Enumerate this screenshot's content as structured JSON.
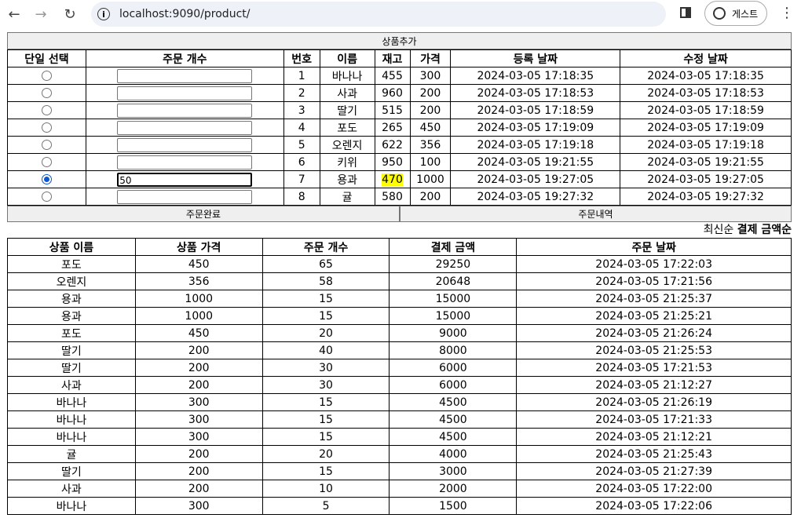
{
  "browser": {
    "url": "localhost:9090/product/",
    "profile_label": "게스트",
    "icons": [
      "back-arrow-icon",
      "forward-arrow-icon",
      "reload-icon",
      "info-icon",
      "side-panel-icon",
      "profile-icon",
      "more-vert-icon"
    ]
  },
  "product": {
    "add_button": "상품추가",
    "headers": [
      "단일 선택",
      "주문 개수",
      "번호",
      "이름",
      "재고",
      "가격",
      "등록 날짜",
      "수정 날짜"
    ],
    "rows": [
      {
        "selected": false,
        "qty": "",
        "id": "1",
        "name": "바나나",
        "stock": "455",
        "price": "300",
        "created": "2024-03-05 17:18:35",
        "updated": "2024-03-05 17:18:35"
      },
      {
        "selected": false,
        "qty": "",
        "id": "2",
        "name": "사과",
        "stock": "960",
        "price": "200",
        "created": "2024-03-05 17:18:53",
        "updated": "2024-03-05 17:18:53"
      },
      {
        "selected": false,
        "qty": "",
        "id": "3",
        "name": "딸기",
        "stock": "515",
        "price": "200",
        "created": "2024-03-05 17:18:59",
        "updated": "2024-03-05 17:18:59"
      },
      {
        "selected": false,
        "qty": "",
        "id": "4",
        "name": "포도",
        "stock": "265",
        "price": "450",
        "created": "2024-03-05 17:19:09",
        "updated": "2024-03-05 17:19:09"
      },
      {
        "selected": false,
        "qty": "",
        "id": "5",
        "name": "오렌지",
        "stock": "622",
        "price": "356",
        "created": "2024-03-05 17:19:18",
        "updated": "2024-03-05 17:19:18"
      },
      {
        "selected": false,
        "qty": "",
        "id": "6",
        "name": "키위",
        "stock": "950",
        "price": "100",
        "created": "2024-03-05 19:21:55",
        "updated": "2024-03-05 19:21:55"
      },
      {
        "selected": true,
        "qty": "50",
        "id": "7",
        "name": "용과",
        "stock": "470",
        "stock_highlight": true,
        "price": "1000",
        "created": "2024-03-05 19:27:05",
        "updated": "2024-03-05 19:27:05"
      },
      {
        "selected": false,
        "qty": "",
        "id": "8",
        "name": "귤",
        "stock": "580",
        "price": "200",
        "created": "2024-03-05 19:27:32",
        "updated": "2024-03-05 19:27:32"
      }
    ],
    "complete_button": "주문완료",
    "history_button": "주문내역",
    "highlight_color": "#ffff00"
  },
  "orders": {
    "sort_prefix": "최신순",
    "sort_active": "결제 금액순",
    "headers": [
      "상품 이름",
      "상품 가격",
      "주문 개수",
      "결제 금액",
      "주문 날짜"
    ],
    "rows": [
      [
        "포도",
        "450",
        "65",
        "29250",
        "2024-03-05 17:22:03"
      ],
      [
        "오렌지",
        "356",
        "58",
        "20648",
        "2024-03-05 17:21:56"
      ],
      [
        "용과",
        "1000",
        "15",
        "15000",
        "2024-03-05 21:25:37"
      ],
      [
        "용과",
        "1000",
        "15",
        "15000",
        "2024-03-05 21:25:21"
      ],
      [
        "포도",
        "450",
        "20",
        "9000",
        "2024-03-05 21:26:24"
      ],
      [
        "딸기",
        "200",
        "40",
        "8000",
        "2024-03-05 21:25:53"
      ],
      [
        "딸기",
        "200",
        "30",
        "6000",
        "2024-03-05 17:21:53"
      ],
      [
        "사과",
        "200",
        "30",
        "6000",
        "2024-03-05 21:12:27"
      ],
      [
        "바나나",
        "300",
        "15",
        "4500",
        "2024-03-05 21:26:19"
      ],
      [
        "바나나",
        "300",
        "15",
        "4500",
        "2024-03-05 17:21:33"
      ],
      [
        "바나나",
        "300",
        "15",
        "4500",
        "2024-03-05 21:12:21"
      ],
      [
        "귤",
        "200",
        "20",
        "4000",
        "2024-03-05 21:25:43"
      ],
      [
        "딸기",
        "200",
        "15",
        "3000",
        "2024-03-05 21:27:39"
      ],
      [
        "사과",
        "200",
        "10",
        "2000",
        "2024-03-05 17:22:00"
      ],
      [
        "바나나",
        "300",
        "5",
        "1500",
        "2024-03-05 17:22:06"
      ]
    ]
  }
}
